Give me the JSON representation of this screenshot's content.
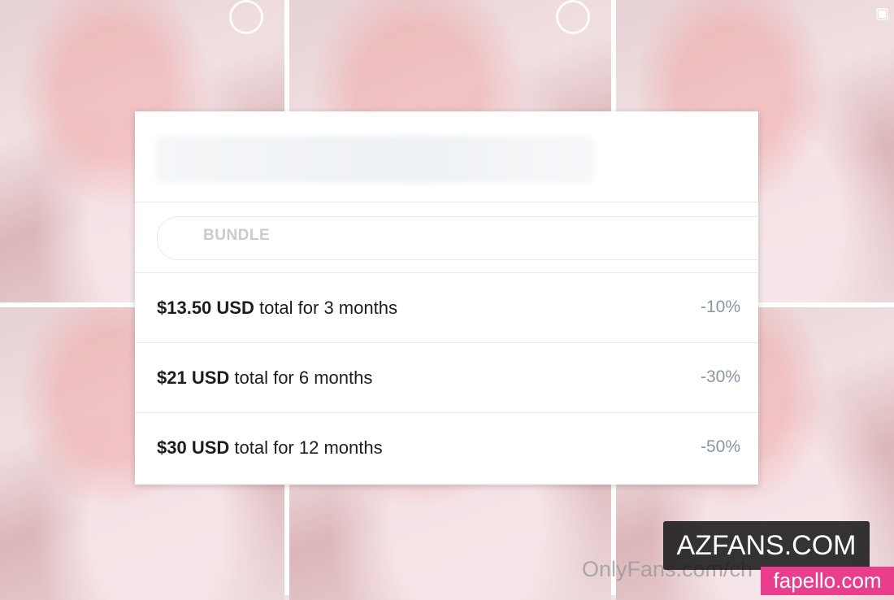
{
  "bundle": {
    "label": "BUNDLE"
  },
  "options": [
    {
      "price": "$13.50 USD",
      "desc": " total for 3 months",
      "discount": "-10%"
    },
    {
      "price": "$21 USD",
      "desc": " total for 6 months",
      "discount": "-30%"
    },
    {
      "price": "$30 USD",
      "desc": " total for 12 months",
      "discount": "-50%"
    }
  ],
  "watermarks": {
    "url": "OnlyFans.com/ch",
    "azfans": "AZFANS.COM",
    "fapello": "fapello.com"
  },
  "icons": {
    "select_ring": "circle-select-icon",
    "gallery": "gallery-icon"
  }
}
